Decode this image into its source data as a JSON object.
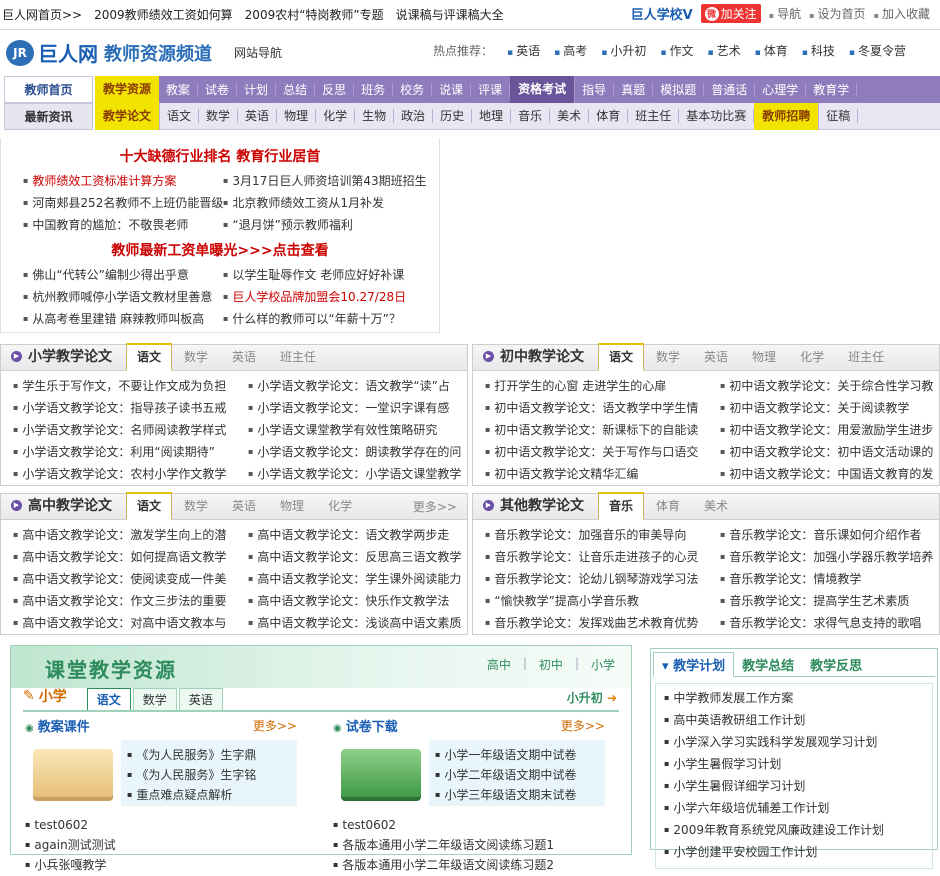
{
  "topbar": {
    "links": [
      "巨人网首页>>",
      "2009教师绩效工资如何算",
      "2009农村“特岗教师”专题",
      "说课稿与评课稿大全"
    ],
    "school": "巨人学校V",
    "follow": "加关注",
    "nav": "导航",
    "homepage": "设为首页",
    "fav": "加入收藏"
  },
  "header": {
    "logo_mark": "JR",
    "site": "巨人网",
    "channel": "教师资源频道",
    "nav": "网站导航",
    "hot_label": "热点推荐：",
    "hot": [
      "英语",
      "高考",
      "小升初",
      "作文",
      "艺术",
      "体育",
      "科技",
      "冬夏令营"
    ]
  },
  "menu": {
    "left": [
      "教师首页",
      "最新资讯"
    ],
    "row1": [
      "教学资源",
      "教案",
      "试卷",
      "计划",
      "总结",
      "反思",
      "班务",
      "校务",
      "说课",
      "评课",
      "资格考试",
      "指导",
      "真题",
      "模拟题",
      "普通话",
      "心理学",
      "教育学"
    ],
    "row2": [
      "教学论文",
      "语文",
      "数学",
      "英语",
      "物理",
      "化学",
      "生物",
      "政治",
      "历史",
      "地理",
      "音乐",
      "美术",
      "体育",
      "班主任",
      "基本功比赛",
      "教师招聘",
      "征稿"
    ]
  },
  "news": {
    "headline1": "十大缺德行业排名 教育行业居首",
    "items1": [
      "教师绩效工资标准计算方案",
      "3月17日巨人师资培训第43期班招生",
      "河南郏县252名教师不上班仍能晋级",
      "北京教师绩效工资从1月补发",
      "中国教育的尴尬：不敬畏老师",
      "“退月饼”预示教师福利"
    ],
    "headline2": "教师最新工资单曝光>>>点击查看",
    "items2": [
      "佛山“代转公”编制少得出乎意",
      "以学生耻辱作文 老师应好好补课",
      "杭州教师喊停小学语文教材里善意",
      "巨人学校品牌加盟会10.27/28日",
      "从高考卷里建错 麻辣教师叫板高",
      "什么样的教师可以“年薪十万”？"
    ]
  },
  "boxes": [
    {
      "title": "小学教学论文",
      "tabs": [
        "语文",
        "数学",
        "英语",
        "班主任"
      ],
      "more": "",
      "items": [
        "学生乐于写作文，不要让作文成为负担",
        "小学语文教学论文：语文教学“读”占",
        "小学语文教学论文：指导孩子读书五戒",
        "小学语文教学论文：一堂识字课有感",
        "小学语文教学论文：名师阅读教学样式",
        "小学语文课堂教学有效性策略研究",
        "小学语文教学论文：利用“阅读期待”",
        "小学语文教学论文：朗读教学存在的问",
        "小学语文教学论文：农村小学作文教学",
        "小学语文教学论文：小学语文课堂教学"
      ]
    },
    {
      "title": "初中教学论文",
      "tabs": [
        "语文",
        "数学",
        "英语",
        "物理",
        "化学",
        "班主任"
      ],
      "more": "",
      "items": [
        "打开学生的心窗 走进学生的心扉",
        "初中语文教学论文：关于综合性学习教",
        "初中语文教学论文：语文教学中学生情",
        "初中语文教学论文：关于阅读教学",
        "初中语文教学论文：新课标下的自能读",
        "初中语文教学论文：用爱激励学生进步",
        "初中语文教学论文：关于写作与口语交",
        "初中语文教学论文：初中语文活动课的",
        "初中语文教学论文精华汇编",
        "初中语文教学论文：中国语文教育的发"
      ]
    },
    {
      "title": "高中教学论文",
      "tabs": [
        "语文",
        "数学",
        "英语",
        "物理",
        "化学"
      ],
      "more": "更多>>",
      "items": [
        "高中语文教学论文：激发学生向上的潜",
        "高中语文教学论文：语文教学两步走",
        "高中语文教学论文：如何提高语文教学",
        "高中语文教学论文：反思高三语文教学",
        "高中语文教学论文：使阅读变成一件美",
        "高中语文教学论文：学生课外阅读能力",
        "高中语文教学论文：作文三步法的重要",
        "高中语文教学论文：快乐作文教学法",
        "高中语文教学论文：对高中语文教本与",
        "高中语文教学论文：浅谈高中语文素质"
      ]
    },
    {
      "title": "其他教学论文",
      "tabs": [
        "音乐",
        "体育",
        "美术"
      ],
      "more": "",
      "items": [
        "音乐教学论文：加强音乐的审美导向",
        "音乐教学论文：音乐课如何介绍作者",
        "音乐教学论文：让音乐走进孩子的心灵",
        "音乐教学论文：加强小学器乐教学培养",
        "音乐教学论文：论幼儿钢琴游戏学习法",
        "音乐教学论文：情境教学",
        "“愉快教学”提高小学音乐教",
        "音乐教学论文：提高学生艺术素质",
        "音乐教学论文：发挥戏曲艺术教育优势",
        "音乐教学论文：求得气息支持的歌唱"
      ]
    }
  ],
  "resources": {
    "banner": "课堂教学资源",
    "levels": [
      "高中",
      "初中",
      "小学"
    ],
    "grade": "小学",
    "tabs": [
      "语文",
      "数学",
      "英语"
    ],
    "xsc": "小升初",
    "lesson": {
      "title": "教案课件",
      "more": "更多>>",
      "items": [
        "《为人民服务》生字鼎",
        "《为人民服务》生字铭",
        "重点难点疑点解析"
      ],
      "below": [
        "test0602",
        "again测试测试",
        "小兵张嘎教学"
      ]
    },
    "exam": {
      "title": "试卷下载",
      "more": "更多>>",
      "items": [
        "小学一年级语文期中试卷",
        "小学二年级语文期中试卷",
        "小学三年级语文期末试卷"
      ],
      "below": [
        "test0602",
        "各版本通用小学二年级语文阅读练习题1",
        "各版本通用小学二年级语文阅读练习题2"
      ]
    }
  },
  "plan": {
    "tabs": [
      "教学计划",
      "教学总结",
      "教学反思"
    ],
    "items": [
      "中学教师发展工作方案",
      "高中英语教研组工作计划",
      "小学深入学习实践科学发展观学习计划",
      "小学生暑假学习计划",
      "小学生暑假详细学习计划",
      "小学六年级培优辅差工作计划",
      "2009年教育系统党风廉政建设工作计划",
      "小学创建平安校园工作计划"
    ]
  }
}
